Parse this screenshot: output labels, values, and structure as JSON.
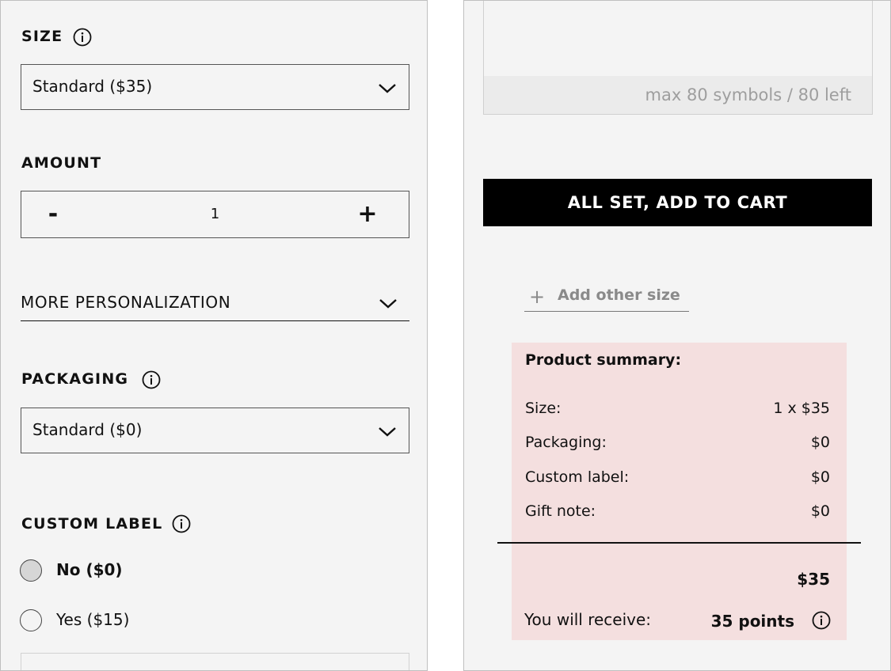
{
  "size": {
    "heading": "SIZE",
    "selected": "Standard ($35)"
  },
  "amount": {
    "heading": "AMOUNT",
    "minus": "-",
    "quantity": "1",
    "plus": "+"
  },
  "personalization": {
    "label": "MORE PERSONALIZATION"
  },
  "packaging": {
    "heading": "PACKAGING",
    "selected": "Standard ($0)"
  },
  "custom_label": {
    "heading": "CUSTOM LABEL",
    "options": [
      {
        "label": "No ($0)",
        "selected": true
      },
      {
        "label": "Yes ($15)",
        "selected": false
      }
    ]
  },
  "note": {
    "counter": "max 80 symbols / 80 left"
  },
  "cart_button": "ALL SET, ADD TO CART",
  "add_size": {
    "plus": "+",
    "label": "Add other size"
  },
  "summary": {
    "title": "Product summary:",
    "rows": [
      {
        "key": "Size:",
        "value": "1 x $35"
      },
      {
        "key": "Packaging:",
        "value": "$0"
      },
      {
        "key": "Custom label:",
        "value": "$0"
      },
      {
        "key": "Gift note:",
        "value": "$0"
      }
    ],
    "total": "$35",
    "points_label": "You will receive:",
    "points_value": "35 points"
  }
}
